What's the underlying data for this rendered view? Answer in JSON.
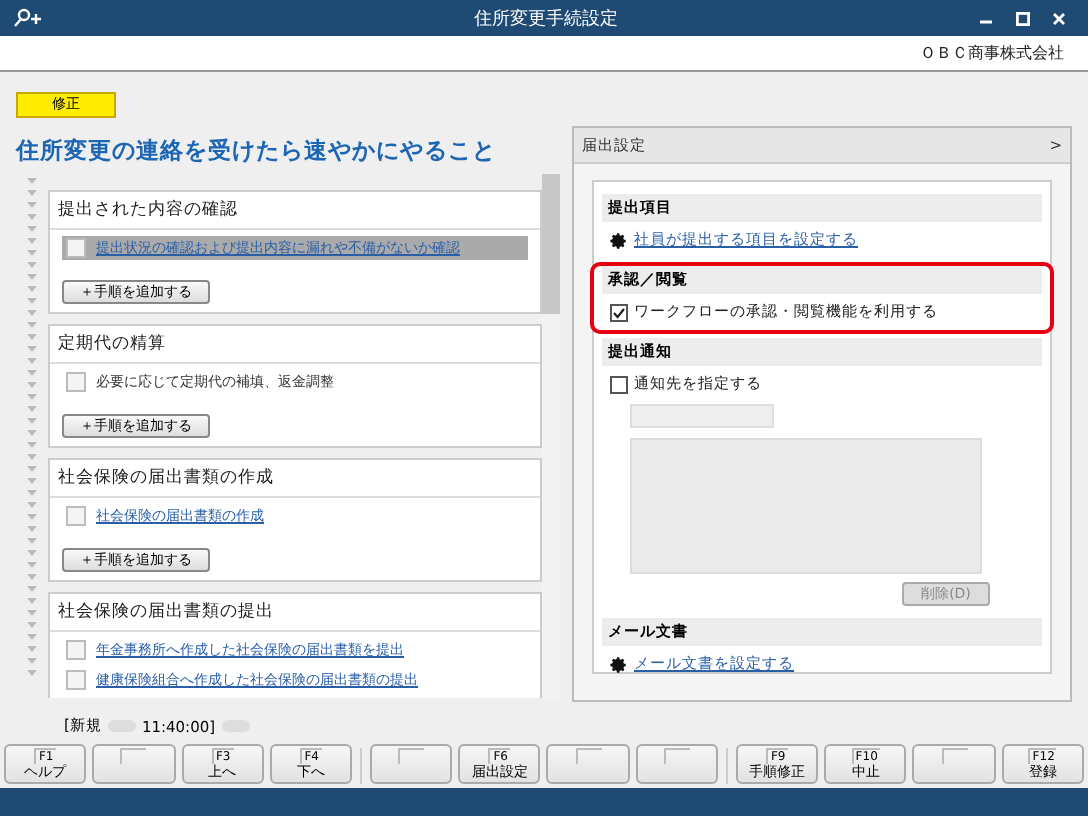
{
  "window": {
    "title": "住所変更手続設定"
  },
  "company": "ＯＢＣ商事株式会社",
  "badge": "修正",
  "heading": "住所変更の連絡を受けたら速やかにやること",
  "sections": [
    {
      "title": "提出された内容の確認",
      "add_button": "＋手順を追加する",
      "tasks": [
        {
          "label": "提出状況の確認および提出内容に漏れや不備がないか確認",
          "kind": "link",
          "checked": false,
          "selected": true
        }
      ]
    },
    {
      "title": "定期代の精算",
      "add_button": "＋手順を追加する",
      "tasks": [
        {
          "label": "必要に応じて定期代の補填、返金調整",
          "kind": "plain",
          "checked": false,
          "selected": false
        }
      ]
    },
    {
      "title": "社会保険の届出書類の作成",
      "add_button": "＋手順を追加する",
      "tasks": [
        {
          "label": "社会保険の届出書類の作成",
          "kind": "link",
          "checked": false,
          "selected": false
        }
      ]
    },
    {
      "title": "社会保険の届出書類の提出",
      "tasks": [
        {
          "label": "年金事務所へ作成した社会保険の届出書類を提出",
          "kind": "link",
          "checked": false,
          "selected": false
        },
        {
          "label": "健康保険組合へ作成した社会保険の届出書類の提出",
          "kind": "link",
          "checked": false,
          "selected": false
        }
      ]
    }
  ],
  "status": {
    "prefix": "[新規",
    "time": "11:40:00]"
  },
  "side_panel": {
    "title": "届出設定",
    "toggle": ">",
    "groups": [
      {
        "title": "提出項目",
        "kind": "link",
        "label": "社員が提出する項目を設定する",
        "highlighted": false
      },
      {
        "title": "承認／閲覧",
        "kind": "checkbox",
        "label": "ワークフローの承認・閲覧機能を利用する",
        "checked": true,
        "highlighted": true
      },
      {
        "title": "提出通知",
        "kind": "notify",
        "label": "通知先を指定する",
        "checked": false,
        "button": "削除(D)",
        "highlighted": false
      },
      {
        "title": "メール文書",
        "kind": "link",
        "label": "メール文書を設定する",
        "highlighted": false
      }
    ]
  },
  "function_keys": [
    {
      "kind": "key",
      "key": "F1",
      "label": "ヘルプ"
    },
    {
      "kind": "blank"
    },
    {
      "kind": "key",
      "key": "F3",
      "label": "上へ"
    },
    {
      "kind": "key",
      "key": "F4",
      "label": "下へ"
    },
    {
      "kind": "blank"
    },
    {
      "kind": "key",
      "key": "F6",
      "label": "届出設定"
    },
    {
      "kind": "blank"
    },
    {
      "kind": "blank"
    },
    {
      "kind": "key",
      "key": "F9",
      "label": "手順修正"
    },
    {
      "kind": "key",
      "key": "F10",
      "label": "中止"
    },
    {
      "kind": "blank"
    },
    {
      "kind": "key",
      "key": "F12",
      "label": "登録"
    }
  ]
}
